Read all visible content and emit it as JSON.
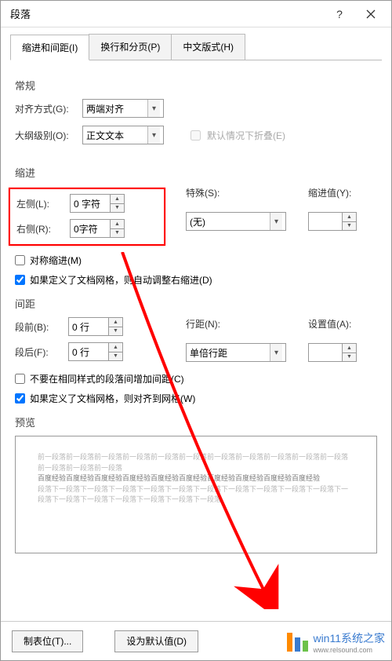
{
  "title": "段落",
  "tabs": {
    "indent": "缩进和间距(I)",
    "linebreak": "换行和分页(P)",
    "chinese": "中文版式(H)"
  },
  "general": {
    "section": "常规",
    "align_label": "对齐方式(G):",
    "align_value": "两端对齐",
    "outline_label": "大纲级别(O):",
    "outline_value": "正文文本",
    "collapse_label": "默认情况下折叠(E)"
  },
  "indent": {
    "section": "缩进",
    "left_label": "左侧(L):",
    "left_value": "0 字符",
    "right_label": "右侧(R):",
    "right_value": "0字符",
    "special_label": "特殊(S):",
    "special_value": "(无)",
    "by_label": "缩进值(Y):",
    "by_value": "",
    "mirror_label": "对称缩进(M)",
    "grid_label": "如果定义了文档网格，则自动调整右缩进(D)"
  },
  "spacing": {
    "section": "间距",
    "before_label": "段前(B):",
    "before_value": "0 行",
    "after_label": "段后(F):",
    "after_value": "0 行",
    "line_label": "行距(N):",
    "line_value": "单倍行距",
    "at_label": "设置值(A):",
    "at_value": "",
    "nospace_label": "不要在相同样式的段落间增加间距(C)",
    "grid_label": "如果定义了文档网格，则对齐到网格(W)"
  },
  "preview": {
    "section": "预览",
    "light1": "前一段落前一段落前一段落前一段落前一段落前一段落前一段落前一段落前一段落前一段落前一段落前一段落前一段落前一段落",
    "dark": "百度经验百度经验百度经验百度经验百度经验百度经验百度经验百度经验百度经验百度经验",
    "light2": "段落下一段落下一段落下一段落下一段落下一段落下一段落下一段落下一段落下一段落下一段落下一段落下一段落下一段落下一段落下一段落下一段落下一段落"
  },
  "footer": {
    "tabs_btn": "制表位(T)...",
    "default_btn": "设为默认值(D)"
  },
  "watermark": "win11系统之家",
  "watermark_url": "www.relsound.com"
}
